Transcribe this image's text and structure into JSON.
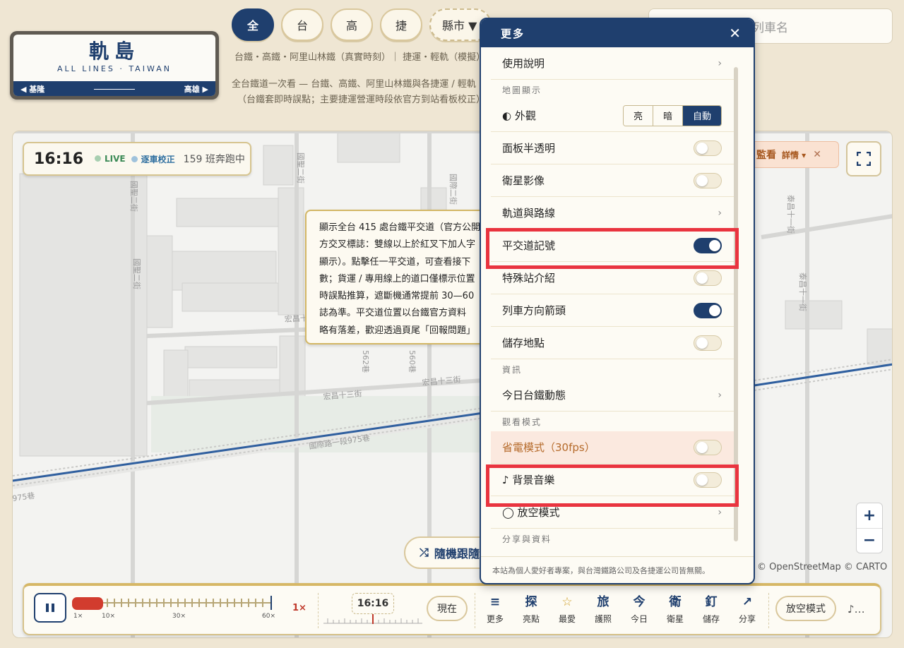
{
  "logo": {
    "title": "軌島",
    "subtitle": "ALL LINES · TAIWAN",
    "left": "◀ 基隆",
    "right": "高雄 ▶"
  },
  "filters": [
    "全",
    "台",
    "高",
    "捷"
  ],
  "filter_dropdown": "縣市 ▼",
  "subtitle1": "台鐵・高鐵・阿里山林鐵（真實時刻）｜ 捷運・輕軌（模擬）",
  "subtitle2a": "全台鐵道一次看 — 台鐵、高鐵、阿里山林鐵與各捷運 / 輕軌",
  "subtitle2b": "（台鐵套即時誤點；主要捷運營運時段依官方到站看板校正）",
  "search": {
    "placeholder": "列車名"
  },
  "status": {
    "time": "16:16",
    "live": "LIVE",
    "corrected": "逐車校正",
    "running": "159 班奔跑中"
  },
  "tooltip_lines": [
    "顯示全台 415 處台鐵平交道（官方公開",
    "方交叉標誌：雙線以上於紅叉下加人字",
    "顯示）。點擊任一平交道，可查看接下",
    "數；貨運 / 專用線上的道口僅標示位置",
    "時誤點推算，遮斷機通常提前 30—60",
    "誌為準。平交道位置以台鐵官方資料",
    "略有落差，歡迎透過頁尾「回報問題」"
  ],
  "watch": {
    "label": "監看",
    "detail": "詳情 ▾",
    "close": "✕"
  },
  "random_follow": "隨機跟隨",
  "attribution": "© OpenStreetMap © CARTO",
  "map_labels": {
    "guoyu2": "國聖二街",
    "guoyu3": "國聖二街",
    "guoji": "國際二街",
    "guoji_road": "國際路一段975巷",
    "honggang": "宏昌十三街",
    "lane560": "560巷",
    "lane562": "562巷",
    "lane975": "975巷",
    "right1": "泰昌十一街",
    "right2": "泰昌十一街",
    "hongchang2": "宏昌十三街",
    "hongchang3": "宏昌十二街"
  },
  "bottom": {
    "speed_labels": [
      "1×",
      "10×",
      "30×",
      "60×"
    ],
    "speed_value": "1×",
    "time": "16:16",
    "now": "現在",
    "nav": [
      {
        "icon": "≡",
        "label": "更多"
      },
      {
        "icon": "探",
        "label": "亮點"
      },
      {
        "icon": "☆",
        "label": "最愛"
      },
      {
        "icon": "旅",
        "label": "護照"
      },
      {
        "icon": "今",
        "label": "今日"
      },
      {
        "icon": "衛",
        "label": "衛星"
      },
      {
        "icon": "釘",
        "label": "儲存"
      },
      {
        "icon": "↗",
        "label": "分享"
      }
    ],
    "idle": "放空模式",
    "music": "♪…"
  },
  "panel": {
    "title": "更多",
    "close": "✕",
    "guide": "使用說明",
    "sec_map": "地圖顯示",
    "appearance": "◐ 外觀",
    "appearance_opts": [
      "亮",
      "暗",
      "自動"
    ],
    "translucent": "面板半透明",
    "satellite": "衛星影像",
    "tracks": "軌道與路線",
    "crossings": "平交道記號",
    "stations": "特殊站介紹",
    "arrows": "列車方向箭頭",
    "saved": "儲存地點",
    "sec_info": "資訊",
    "today": "今日台鐵動態",
    "sec_view": "觀看模式",
    "power": "省電模式（30fps）",
    "bgm": "♪ 背景音樂",
    "idle": "◯ 放空模式",
    "sec_share": "分享與資料",
    "footer": "本站為個人愛好者專案，與台灣鐵路公司及各捷運公司皆無關。",
    "toggles": {
      "translucent": false,
      "satellite": false,
      "crossings": true,
      "stations": false,
      "arrows": true,
      "saved": false,
      "power": false,
      "bgm": false
    }
  },
  "colors": {
    "accent": "#1f3f6e",
    "highlight": "#e9343f",
    "rail": "#2f5f9f",
    "live": "#3c8a57",
    "corrected": "#2f6fa0"
  }
}
